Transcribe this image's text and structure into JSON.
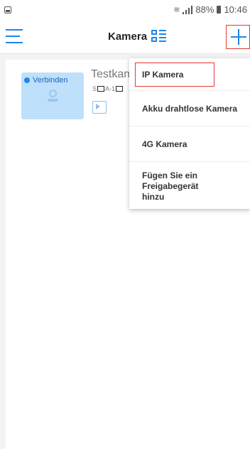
{
  "status_bar": {
    "battery": "88%",
    "time": "10:46"
  },
  "header": {
    "title": "Kamera"
  },
  "device": {
    "status": "Verbinden",
    "name": "Testkam",
    "serial_prefix": "S",
    "serial_mid": "A-1"
  },
  "menu": {
    "items": [
      {
        "label": "IP Kamera"
      },
      {
        "label": "Akku drahtlose Kamera"
      },
      {
        "label": "4G Kamera"
      },
      {
        "label": "Fügen Sie ein Freigabegerät hinzu"
      }
    ]
  },
  "colors": {
    "accent": "#1f86e8",
    "highlight": "#e53935"
  }
}
